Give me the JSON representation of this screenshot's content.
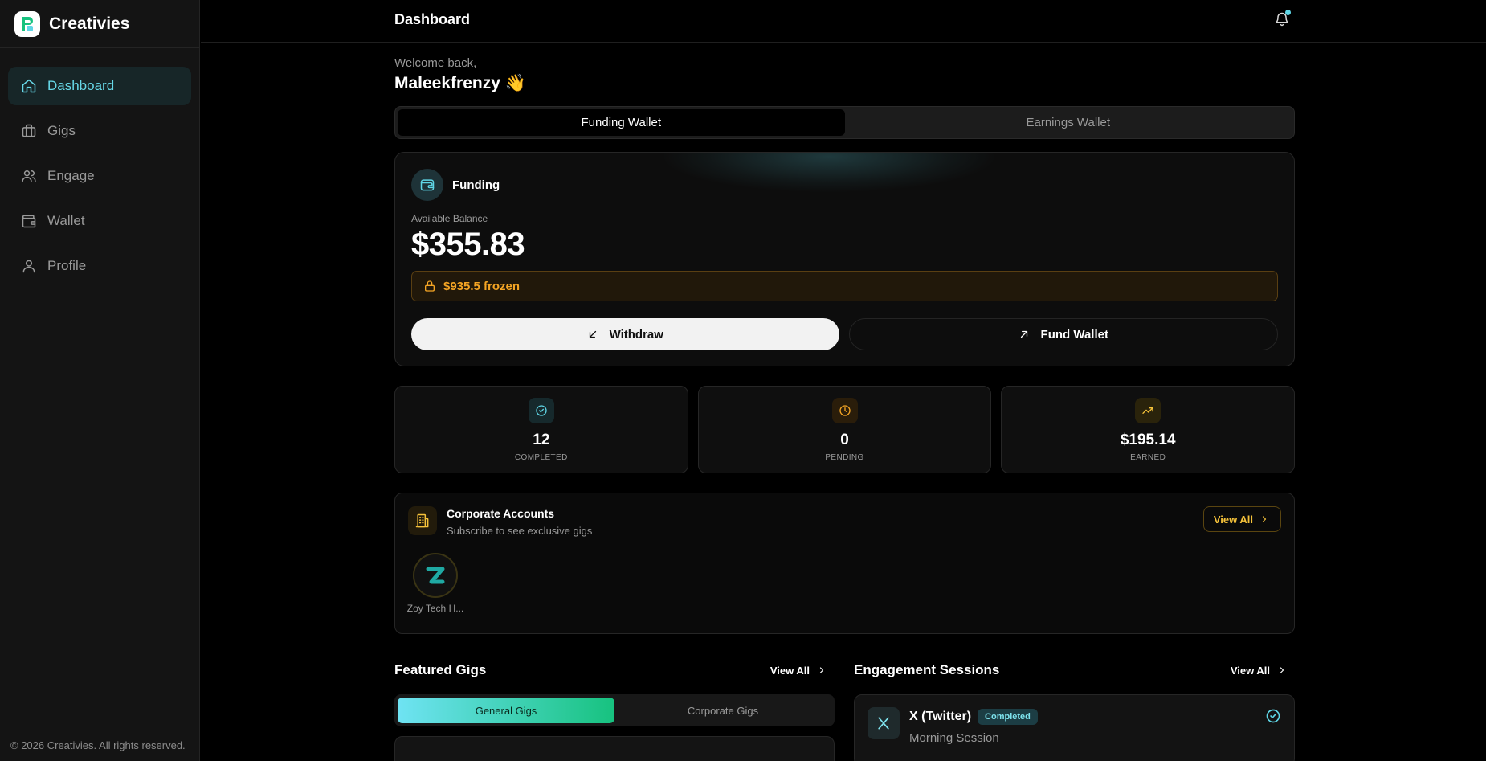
{
  "brand": {
    "name": "Creativies"
  },
  "sidebar": {
    "items": [
      {
        "label": "Dashboard",
        "icon": "home-icon",
        "active": true
      },
      {
        "label": "Gigs",
        "icon": "briefcase-icon"
      },
      {
        "label": "Engage",
        "icon": "users-icon"
      },
      {
        "label": "Wallet",
        "icon": "wallet-icon"
      },
      {
        "label": "Profile",
        "icon": "user-icon"
      }
    ],
    "footer": "© 2026 Creativies. All rights reserved."
  },
  "header": {
    "title": "Dashboard"
  },
  "welcome": {
    "greeting": "Welcome back,",
    "username": "Maleekfrenzy",
    "emoji": "👋"
  },
  "wallet_tabs": {
    "funding": "Funding Wallet",
    "earnings": "Earnings Wallet"
  },
  "wallet": {
    "label": "Funding",
    "available_label": "Available Balance",
    "balance": "$355.83",
    "frozen": "$935.5 frozen",
    "withdraw": "Withdraw",
    "fund": "Fund Wallet"
  },
  "stats": [
    {
      "value": "12",
      "label": "COMPLETED",
      "color": "#5fd6e6"
    },
    {
      "value": "0",
      "label": "PENDING",
      "color": "#f5a524"
    },
    {
      "value": "$195.14",
      "label": "EARNED",
      "color": "#f5c23a"
    }
  ],
  "corporate": {
    "title": "Corporate Accounts",
    "subtitle": "Subscribe to see exclusive gigs",
    "view_all": "View All",
    "accounts": [
      {
        "name": "Zoy Tech H...",
        "initial": "Z"
      }
    ]
  },
  "featured": {
    "title": "Featured Gigs",
    "view_all": "View All",
    "tabs": {
      "general": "General Gigs",
      "corporate": "Corporate Gigs"
    }
  },
  "engagement": {
    "title": "Engagement Sessions",
    "view_all": "View All",
    "sessions": [
      {
        "platform": "X (Twitter)",
        "status": "Completed",
        "session": "Morning Session"
      }
    ]
  },
  "colors": {
    "accent": "#5fd6e6",
    "warning": "#f5a524",
    "gold": "#f5c23a"
  }
}
